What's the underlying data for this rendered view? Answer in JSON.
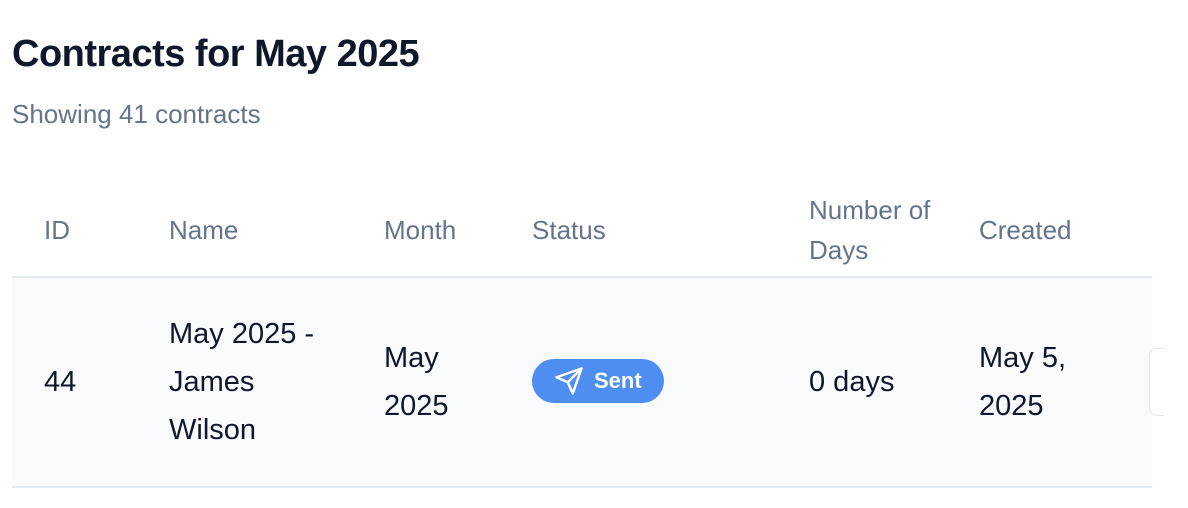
{
  "page": {
    "title": "Contracts for May 2025",
    "subtitle": "Showing 41 contracts"
  },
  "table": {
    "columns": {
      "id": "ID",
      "name": "Name",
      "month": "Month",
      "status": "Status",
      "days": "Number of Days",
      "created": "Created"
    },
    "rows": [
      {
        "id": "44",
        "name": "May 2025 - James Wilson",
        "month": "May 2025",
        "status": "Sent",
        "status_icon": "send-icon",
        "status_color": "#4d8ef0",
        "days": "0 days",
        "created": "May 5, 2025"
      }
    ]
  },
  "colors": {
    "title": "#0f172a",
    "muted": "#64748b",
    "row_background": "#f8fafc",
    "border": "#e2e8f0"
  }
}
